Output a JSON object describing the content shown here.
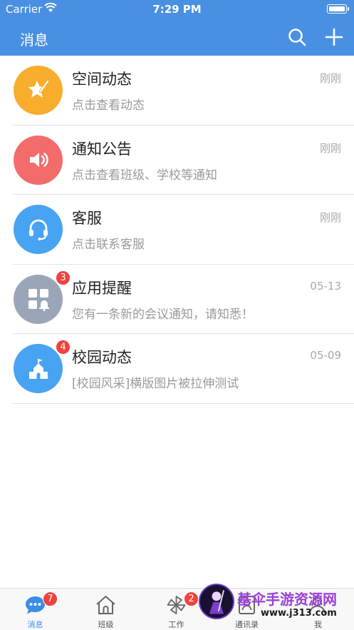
{
  "status_bar": {
    "carrier": "Carrier",
    "time": "7:29 PM"
  },
  "nav": {
    "title": "消息",
    "search_icon": "search-icon",
    "add_icon": "plus-icon"
  },
  "conversations": [
    {
      "name": "空间动态",
      "subtitle": "点击查看动态",
      "time": "刚刚",
      "badge": "",
      "icon": "star-pen-icon",
      "color": "#f8ad2c"
    },
    {
      "name": "通知公告",
      "subtitle": "点击查看班级、学校等通知",
      "time": "刚刚",
      "badge": "",
      "icon": "speaker-icon",
      "color": "#f46b6b"
    },
    {
      "name": "客服",
      "subtitle": "点击联系客服",
      "time": "刚刚",
      "badge": "",
      "icon": "headset-icon",
      "color": "#48a3f2"
    },
    {
      "name": "应用提醒",
      "subtitle": "您有一条新的会议通知，请知悉！",
      "time": "05-13",
      "badge": "3",
      "icon": "apps-bell-icon",
      "color": "#9aa6b8"
    },
    {
      "name": "校园动态",
      "subtitle": "[校园风采]横版图片被拉伸测试",
      "time": "05-09",
      "badge": "4",
      "icon": "school-icon",
      "color": "#48a3f2"
    }
  ],
  "tabs": [
    {
      "label": "消息",
      "badge": "7",
      "active": true,
      "icon": "chat-bubble-icon"
    },
    {
      "label": "班级",
      "badge": "",
      "active": false,
      "icon": "house-icon"
    },
    {
      "label": "工作",
      "badge": "2",
      "active": false,
      "icon": "pinwheel-icon"
    },
    {
      "label": "通讯录",
      "badge": "",
      "active": false,
      "icon": "contacts-icon"
    },
    {
      "label": "我",
      "badge": "",
      "active": false,
      "icon": "person-icon"
    }
  ],
  "watermark": {
    "name": "基伞手游资源网",
    "url": "www.j313.com"
  },
  "colors": {
    "primary": "#4a90e2",
    "tab_active": "#3b8de8",
    "badge": "#f0423c"
  }
}
